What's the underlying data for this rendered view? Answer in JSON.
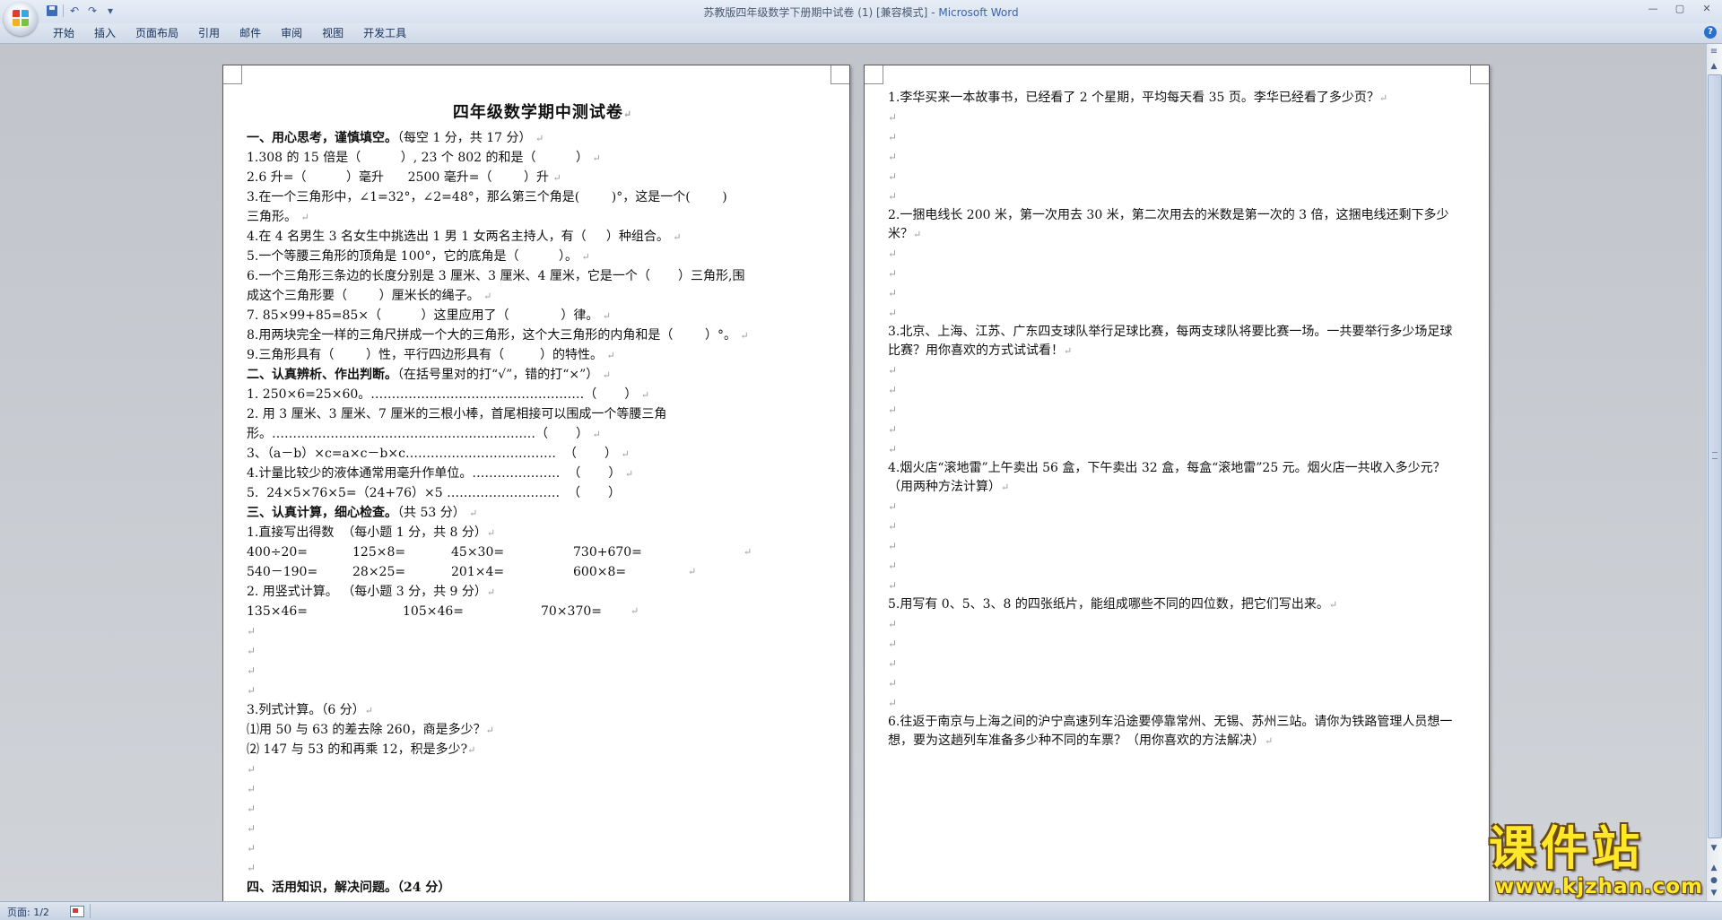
{
  "window": {
    "title_doc": "苏教版四年级数学下册期中试卷 (1) [兼容模式]",
    "title_sep": " - ",
    "title_app": "Microsoft Word",
    "minimize": "—",
    "maximize": "▢",
    "close": "✕",
    "help": "?"
  },
  "qat": {
    "undo": "↶",
    "redo": "↷",
    "customize": "▾"
  },
  "ribbon": {
    "tabs": [
      "开始",
      "插入",
      "页面布局",
      "引用",
      "邮件",
      "审阅",
      "视图",
      "开发工具"
    ]
  },
  "para_mark": "↵",
  "left_page": {
    "title": "四年级数学期中测试卷",
    "section1": {
      "heading": "一、用心思考，谨慎填空。",
      "note": "（每空 1 分，共 17 分）"
    },
    "q1_1": "1.308 的 15 倍是（          ）, 23 个 802 的和是（          ）",
    "q1_2": "2.6 升=（          ）毫升      2500 毫升=（        ）升",
    "q1_3a": "3.在一个三角形中，∠1=32°，∠2=48°，那么第三个角是(        )°，这是一个(        )",
    "q1_3b": "三角形。",
    "q1_4": "4.在 4 名男生 3 名女生中挑选出 1 男 1 女两名主持人，有（     ）种组合。",
    "q1_5": "5.一个等腰三角形的顶角是 100°，它的底角是（          ）。",
    "q1_6a": "6.一个三角形三条边的长度分别是 3 厘米、3 厘米、4 厘米，它是一个（       ）三角形,围",
    "q1_6b": "成这个三角形要（        ）厘米长的绳子。",
    "q1_7": "7. 85×99+85=85×（          ）这里应用了（             ）律。",
    "q1_8": "8.用两块完全一样的三角尺拼成一个大的三角形，这个大三角形的内角和是（        ）°。",
    "q1_9": "9.三角形具有（        ）性，平行四边形具有（         ）的特性。",
    "section2": {
      "heading": "二、认真辨析、作出判断。",
      "note": "（在括号里对的打“√”，错的打“×”）"
    },
    "q2_1": "1. 250×6=25×60。……………………………………………（       ）",
    "q2_2a": "2. 用 3 厘米、3 厘米、7 厘米的三根小棒，首尾相接可以围成一个等腰三角",
    "q2_2b": "形。………………………………………………………（       ）",
    "q2_3": "3、（a－b）×c=a×c－b×c………………………………  （       ）",
    "q2_4": "4.计量比较少的液体通常用毫升作单位。…………………  （       ）",
    "q2_5": "5.  24×5×76×5=（24+76）×5 ………………………  （       ）",
    "section3": {
      "heading": "三、认真计算，细心检查。",
      "note": "（共 53 分）"
    },
    "q3_1_title": "1.直接写出得数  （每小题 1 分，共 8 分）",
    "q3_1_row1": [
      "400÷20=",
      "125×8=",
      "45×30=",
      "730+670="
    ],
    "q3_1_row2": [
      "540－190=",
      "28×25=",
      "201×4=",
      "600×8="
    ],
    "q3_2_title": "2. 用竖式计算。 （每小题 3 分，共 9 分）",
    "q3_2_row": [
      "135×46=",
      "105×46=",
      "70×370="
    ],
    "q3_3_title": "3.列式计算。（6 分）",
    "q3_3_1": "⑴用 50 与 63 的差去除 260，商是多少？",
    "q3_3_2": "⑵ 147 与 53 的和再乘 12，积是多少?",
    "section4_partial": "四、活用知识，解决问题。（24 分）"
  },
  "right_page": {
    "p1": "1.李华买来一本故事书，已经看了 2 个星期，平均每天看 35 页。李华已经看了多少页？",
    "p2": "2.一捆电线长 200 米，第一次用去 30 米，第二次用去的米数是第一次的 3 倍，这捆电线还剩下多少米？",
    "p3": "3.北京、上海、江苏、广东四支球队举行足球比赛，每两支球队将要比赛一场。一共要举行多少场足球比赛？用你喜欢的方式试试看！",
    "p4": "4.烟火店“滚地雷”上午卖出 56 盒，下午卖出 32 盒，每盒“滚地雷”25 元。烟火店一共收入多少元？（用两种方法计算）",
    "p5": "5.用写有 0、5、3、8 的四张纸片，能组成哪些不同的四位数，把它们写出来。",
    "p6": "6.往返于南京与上海之间的沪宁高速列车沿途要停靠常州、无锡、苏州三站。请你为铁路管理人员想一想，要为这趟列车准备多少种不同的车票？（用你喜欢的方法解决）"
  },
  "scrollbar": {
    "ruler_toggle": "≡",
    "up": "▲",
    "down": "▼",
    "prev_page": "▲",
    "browse": "●",
    "next_page": "▼"
  },
  "statusbar": {
    "page": "页面: 1/2"
  },
  "watermark": {
    "text": "课件站",
    "url": "www.kjzhan.com"
  }
}
